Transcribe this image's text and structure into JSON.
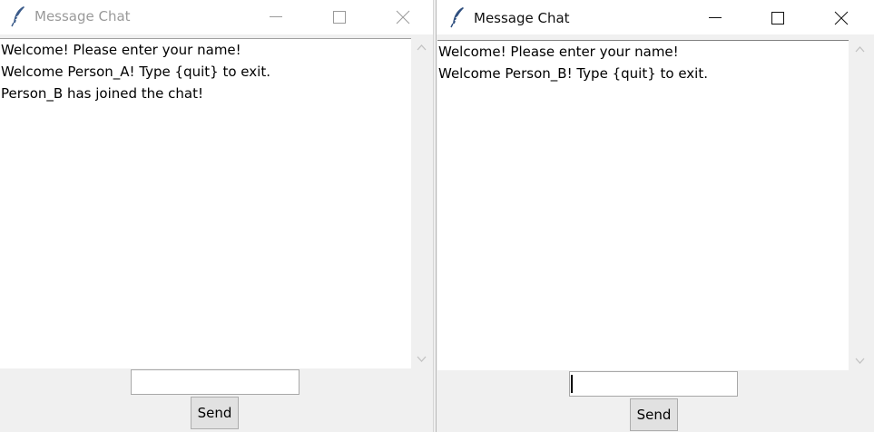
{
  "windows": [
    {
      "title": "Message Chat",
      "focused": false,
      "icon": "feather-icon",
      "messages": [
        "Welcome! Please enter your name!",
        "Welcome Person_A! Type {quit} to exit.",
        "Person_B has joined the chat!"
      ],
      "entry_value": "",
      "send_label": "Send"
    },
    {
      "title": "Message Chat",
      "focused": true,
      "icon": "feather-icon",
      "messages": [
        "Welcome! Please enter your name!",
        "Welcome Person_B! Type {quit} to exit."
      ],
      "entry_value": "",
      "send_label": "Send"
    }
  ],
  "colors": {
    "title_inactive": "#9a9a9a",
    "title_active": "#111111",
    "window_bg": "#f0f0f0",
    "button_bg": "#e1e1e1"
  }
}
